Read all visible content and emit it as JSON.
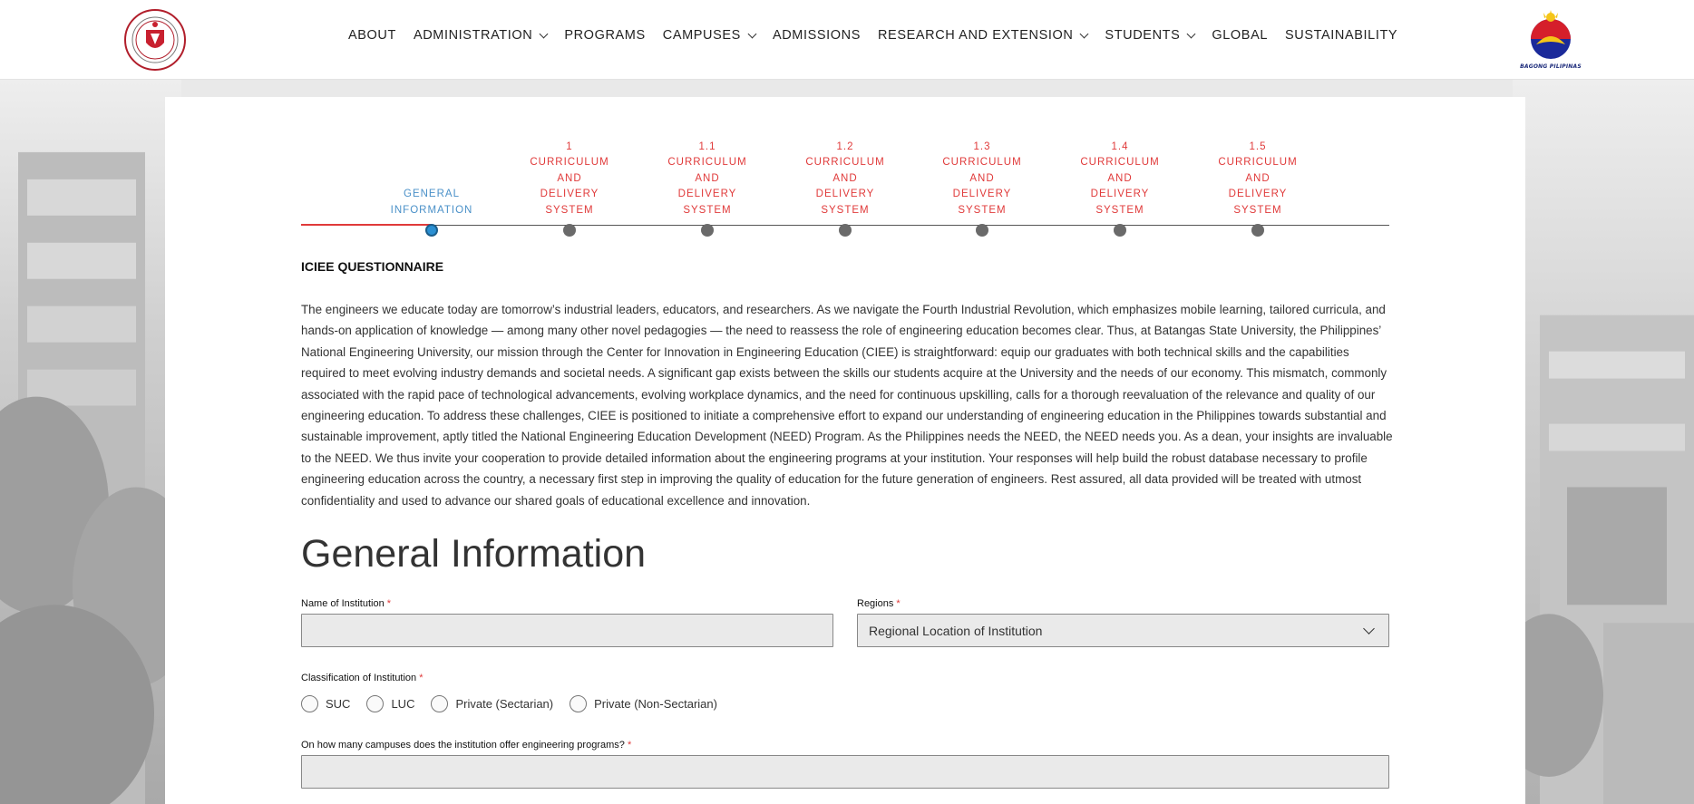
{
  "header": {
    "nav": [
      {
        "label": "ABOUT",
        "dropdown": false
      },
      {
        "label": "ADMINISTRATION",
        "dropdown": true
      },
      {
        "label": "PROGRAMS",
        "dropdown": false
      },
      {
        "label": "CAMPUSES",
        "dropdown": true
      },
      {
        "label": "ADMISSIONS",
        "dropdown": false
      },
      {
        "label": "RESEARCH AND EXTENSION",
        "dropdown": true
      },
      {
        "label": "STUDENTS",
        "dropdown": true
      },
      {
        "label": "GLOBAL",
        "dropdown": false
      },
      {
        "label": "SUSTAINABILITY",
        "dropdown": false
      }
    ],
    "right_logo_text": "BAGONG PILIPINAS",
    "left_logo_icon": "university-seal-icon",
    "right_logo_icon": "bagong-pilipinas-logo-icon"
  },
  "stepper": {
    "steps": [
      {
        "lines": [
          "GENERAL",
          "INFORMATION"
        ],
        "state": "active"
      },
      {
        "lines": [
          "1",
          "CURRICULUM",
          "AND",
          "DELIVERY",
          "SYSTEM"
        ],
        "state": "todo"
      },
      {
        "lines": [
          "1.1",
          "CURRICULUM",
          "AND",
          "DELIVERY",
          "SYSTEM"
        ],
        "state": "todo"
      },
      {
        "lines": [
          "1.2",
          "CURRICULUM",
          "AND",
          "DELIVERY",
          "SYSTEM"
        ],
        "state": "todo"
      },
      {
        "lines": [
          "1.3",
          "CURRICULUM",
          "AND",
          "DELIVERY",
          "SYSTEM"
        ],
        "state": "todo"
      },
      {
        "lines": [
          "1.4",
          "CURRICULUM",
          "AND",
          "DELIVERY",
          "SYSTEM"
        ],
        "state": "todo"
      },
      {
        "lines": [
          "1.5",
          "CURRICULUM",
          "AND",
          "DELIVERY",
          "SYSTEM"
        ],
        "state": "todo"
      }
    ]
  },
  "questionnaire": {
    "heading": "ICIEE QUESTIONNAIRE",
    "intro": "The engineers we educate today are tomorrow’s industrial leaders, educators, and researchers. As we navigate the Fourth Industrial Revolution, which emphasizes mobile learning, tailored curricula, and hands-on application of knowledge — among many other novel pedagogies — the need to reassess the role of engineering education becomes clear. Thus, at Batangas State University, the Philippines’ National Engineering University, our mission through the Center for Innovation in Engineering Education (CIEE) is straightforward: equip our graduates with both technical skills and the capabilities required to meet evolving industry demands and societal needs. A significant gap exists between the skills our students acquire at the University and the needs of our economy. This mismatch, commonly associated with the rapid pace of technological advancements, evolving workplace dynamics, and the need for continuous upskilling, calls for a thorough reevaluation of the relevance and quality of our engineering education. To address these challenges, CIEE is positioned to initiate a comprehensive effort to expand our understanding of engineering education in the Philippines towards substantial and sustainable improvement, aptly titled the National Engineering Education Development (NEED) Program. As the Philippines needs the NEED, the NEED needs you. As a dean, your insights are invaluable to the NEED. We thus invite your cooperation to provide detailed information about the engineering programs at your institution. Your responses will help build the robust database necessary to profile engineering education across the country, a necessary first step in improving the quality of education for the future generation of engineers. Rest assured, all data provided will be treated with utmost confidentiality and used to advance our shared goals of educational excellence and innovation."
  },
  "form": {
    "title": "General Information",
    "institution_label": "Name of Institution",
    "institution_value": "",
    "regions_label": "Regions",
    "regions_selected": "Regional Location of Institution",
    "classification_label": "Classification of Institution",
    "classification_options": [
      "SUC",
      "LUC",
      "Private (Sectarian)",
      "Private (Non-Sectarian)"
    ],
    "campuses_label": "On how many campuses does the institution offer engineering programs?",
    "campuses_value": "",
    "required_mark": "*"
  },
  "colors": {
    "accent_red": "#e03a3a",
    "active_blue": "#2a8fd2",
    "input_bg": "#eaeaea"
  }
}
